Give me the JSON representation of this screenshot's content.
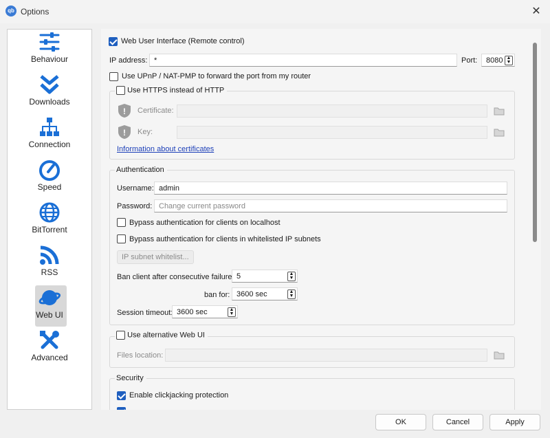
{
  "window": {
    "title": "Options",
    "app_icon_text": "qb"
  },
  "sidebar": {
    "items": [
      {
        "label": "Behaviour",
        "icon": "sliders-icon"
      },
      {
        "label": "Downloads",
        "icon": "double-chevron-down-icon"
      },
      {
        "label": "Connection",
        "icon": "network-icon"
      },
      {
        "label": "Speed",
        "icon": "speedometer-icon"
      },
      {
        "label": "BitTorrent",
        "icon": "globe-icon"
      },
      {
        "label": "RSS",
        "icon": "rss-icon"
      },
      {
        "label": "Web UI",
        "icon": "planet-icon",
        "active": true
      },
      {
        "label": "Advanced",
        "icon": "tools-icon"
      }
    ]
  },
  "webui": {
    "enable_label": "Web User Interface (Remote control)",
    "enabled": true,
    "ip_label": "IP address:",
    "ip_value": "*",
    "port_label": "Port:",
    "port_value": "8080",
    "upnp_label": "Use UPnP / NAT-PMP to forward the port from my router",
    "https_label": "Use HTTPS instead of HTTP",
    "cert_label": "Certificate:",
    "key_label": "Key:",
    "cert_link": "Information about certificates"
  },
  "auth": {
    "title": "Authentication",
    "username_label": "Username:",
    "username_value": "admin",
    "password_label": "Password:",
    "password_placeholder": "Change current password",
    "bypass_localhost": "Bypass authentication for clients on localhost",
    "bypass_whitelist": "Bypass authentication for clients in whitelisted IP subnets",
    "whitelist_button": "IP subnet whitelist...",
    "ban_label": "Ban client after consecutive failures:",
    "ban_value": "5",
    "ban_for_label": "ban for:",
    "ban_for_value": "3600 sec",
    "session_label": "Session timeout:",
    "session_value": "3600 sec"
  },
  "alt_ui": {
    "label": "Use alternative Web UI",
    "files_label": "Files location:"
  },
  "security": {
    "title": "Security",
    "clickjacking_label": "Enable clickjacking protection"
  },
  "buttons": {
    "ok": "OK",
    "cancel": "Cancel",
    "apply": "Apply"
  },
  "colors": {
    "accent": "#1f5fbf",
    "icon_blue": "#1a6fd6",
    "link": "#1c3fb8"
  }
}
